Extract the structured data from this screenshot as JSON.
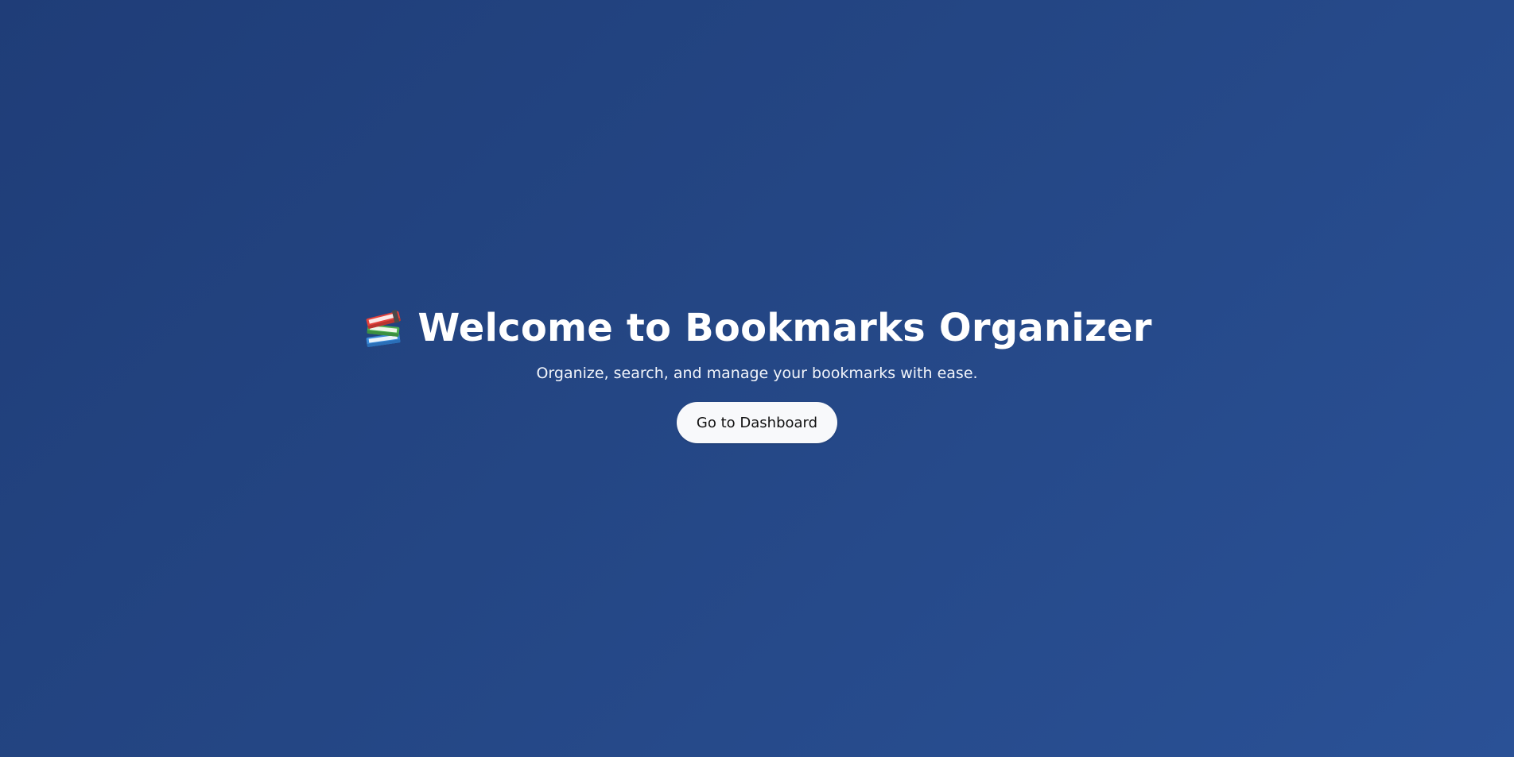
{
  "hero": {
    "icon": "books-icon",
    "title": "Welcome to Bookmarks Organizer",
    "subtitle": "Organize, search, and manage your bookmarks with ease.",
    "cta_label": "Go to Dashboard"
  },
  "colors": {
    "background_start": "#1f3d78",
    "background_end": "#2a5196",
    "text": "#ffffff",
    "button_bg": "#f8f9fb",
    "button_text": "#111111"
  }
}
